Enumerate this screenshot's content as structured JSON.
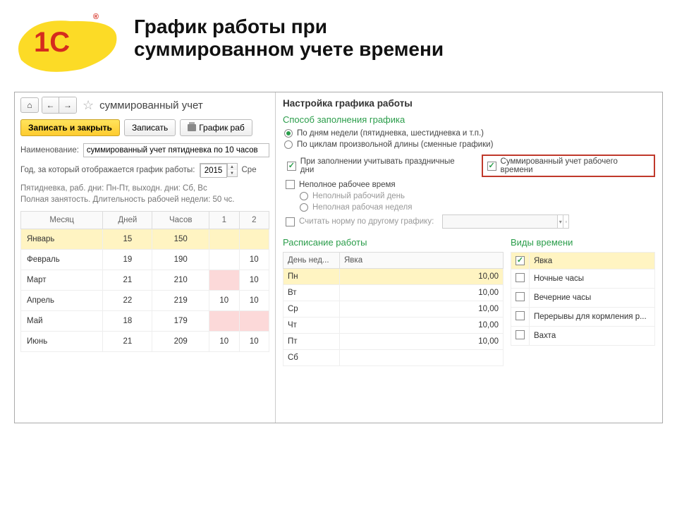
{
  "header": {
    "title_line1": "График работы при",
    "title_line2": "суммированном учете времени"
  },
  "left": {
    "window_title": "суммированный учет",
    "btn_save_close": "Записать и закрыть",
    "btn_save": "Записать",
    "btn_print": "График раб",
    "label_name": "Наименование:",
    "name_value": "суммированный учет пятидневка по 10 часов",
    "label_year": "Год, за который отображается график работы:",
    "year_value": "2015",
    "label_avg": "Сре",
    "info1": "Пятидневка, раб. дни: Пн-Пт, выходн. дни: Сб, Вс",
    "info2": "Полная занятость. Длительность рабочей недели: 50 чс.",
    "cols": {
      "month": "Месяц",
      "days": "Дней",
      "hours": "Часов",
      "c1": "1",
      "c2": "2"
    },
    "rows": [
      {
        "m": "Январь",
        "d": "15",
        "h": "150",
        "c1": "",
        "c2": "",
        "sel": true,
        "p1": false,
        "p2": false
      },
      {
        "m": "Февраль",
        "d": "19",
        "h": "190",
        "c1": "",
        "c2": "10",
        "sel": false,
        "p1": false,
        "p2": false
      },
      {
        "m": "Март",
        "d": "21",
        "h": "210",
        "c1": "",
        "c2": "10",
        "sel": false,
        "p1": true,
        "p2": false
      },
      {
        "m": "Апрель",
        "d": "22",
        "h": "219",
        "c1": "10",
        "c2": "10",
        "sel": false,
        "p1": false,
        "p2": false
      },
      {
        "m": "Май",
        "d": "18",
        "h": "179",
        "c1": "",
        "c2": "",
        "sel": false,
        "p1": true,
        "p2": true
      },
      {
        "m": "Июнь",
        "d": "21",
        "h": "209",
        "c1": "10",
        "c2": "10",
        "sel": false,
        "p1": false,
        "p2": false
      }
    ]
  },
  "right": {
    "title": "Настройка графика работы",
    "section_fill": "Способ заполнения графика",
    "radio_weekdays": "По дням недели (пятидневка, шестидневка и т.п.)",
    "radio_cycles": "По циклам произвольной длины (сменные графики)",
    "chk_holidays": "При заполнении учитывать праздничные дни",
    "chk_summed": "Суммированный учет рабочего времени",
    "chk_parttime": "Неполное рабочее время",
    "radio_partday": "Неполный рабочий день",
    "radio_partweek": "Неполная рабочая неделя",
    "chk_othernorm": "Считать норму по другому графику:",
    "section_sched": "Расписание работы",
    "section_types": "Виды времени",
    "sched_cols": {
      "day": "День нед...",
      "attend": "Явка"
    },
    "sched_rows": [
      {
        "d": "Пн",
        "v": "10,00",
        "sel": true
      },
      {
        "d": "Вт",
        "v": "10,00",
        "sel": false
      },
      {
        "d": "Ср",
        "v": "10,00",
        "sel": false
      },
      {
        "d": "Чт",
        "v": "10,00",
        "sel": false
      },
      {
        "d": "Пт",
        "v": "10,00",
        "sel": false
      },
      {
        "d": "Сб",
        "v": "",
        "sel": false
      }
    ],
    "types_rows": [
      {
        "c": true,
        "n": "Явка",
        "sel": true
      },
      {
        "c": false,
        "n": "Ночные часы",
        "sel": false
      },
      {
        "c": false,
        "n": "Вечерние часы",
        "sel": false
      },
      {
        "c": false,
        "n": "Перерывы для кормления р...",
        "sel": false
      },
      {
        "c": false,
        "n": "Вахта",
        "sel": false
      }
    ]
  }
}
